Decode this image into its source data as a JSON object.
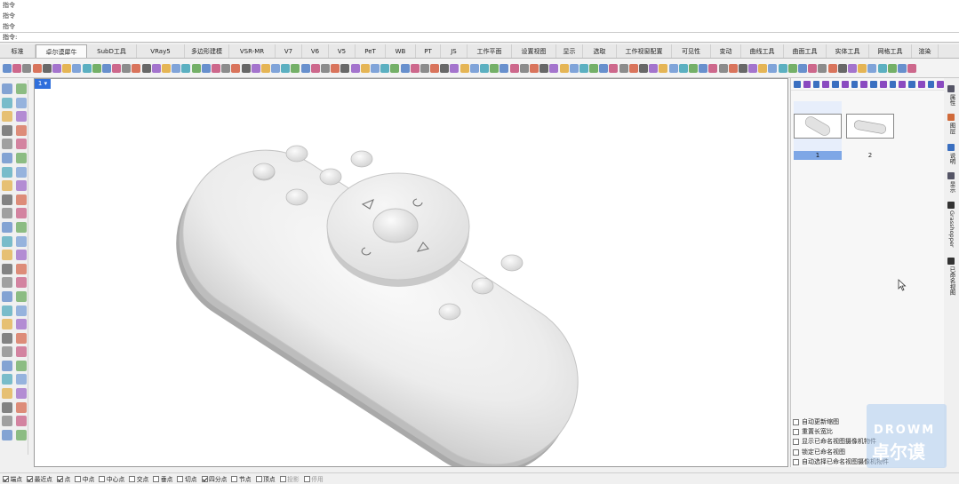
{
  "command_history": [
    "指令",
    "指令",
    "指令"
  ],
  "command_prompt": "指令:",
  "tabs": [
    {
      "label": "标准",
      "w": 40
    },
    {
      "label": "卓尔谟犀牛",
      "w": 58,
      "active": true
    },
    {
      "label": "SubD工具",
      "w": 56
    },
    {
      "label": "VRay5",
      "w": 54
    },
    {
      "label": "多边形建模",
      "w": 50
    },
    {
      "label": "VSR-MR",
      "w": 52
    },
    {
      "label": "V7",
      "w": 30
    },
    {
      "label": "V6",
      "w": 30
    },
    {
      "label": "V5",
      "w": 30
    },
    {
      "label": "PeT",
      "w": 34
    },
    {
      "label": "WB",
      "w": 34
    },
    {
      "label": "PT",
      "w": 28
    },
    {
      "label": "JS",
      "w": 30
    },
    {
      "label": "工作平面",
      "w": 50
    },
    {
      "label": "设置视图",
      "w": 50
    },
    {
      "label": "显示",
      "w": 30
    },
    {
      "label": "选取",
      "w": 38
    },
    {
      "label": "工作视窗配置",
      "w": 62
    },
    {
      "label": "可见性",
      "w": 44
    },
    {
      "label": "变动",
      "w": 34
    },
    {
      "label": "曲线工具",
      "w": 48
    },
    {
      "label": "曲面工具",
      "w": 48
    },
    {
      "label": "实体工具",
      "w": 48
    },
    {
      "label": "网格工具",
      "w": 48
    },
    {
      "label": "渲染",
      "w": 30
    }
  ],
  "viewport": {
    "tab_label": "1"
  },
  "right_panel": {
    "thumbnails": [
      {
        "label": "1",
        "selected": true
      },
      {
        "label": "2",
        "selected": false
      }
    ],
    "options": [
      {
        "label": "自动更新缩图",
        "checked": false
      },
      {
        "label": "重置长宽比",
        "checked": false
      },
      {
        "label": "显示已命名视图摄像机物件",
        "checked": false
      },
      {
        "label": "锁定已命名视图",
        "checked": false
      },
      {
        "label": "自动选择已命名视图摄像机物件",
        "checked": false
      }
    ]
  },
  "side_tabs": [
    "属性",
    "图层",
    "说明",
    "显示",
    "Grasshopper",
    "已命名视图"
  ],
  "watermark": {
    "en": "DROWM",
    "cn": "卓尔谟"
  },
  "snaps": [
    {
      "label": "端点",
      "checked": true
    },
    {
      "label": "最近点",
      "checked": true
    },
    {
      "label": "点",
      "checked": true
    },
    {
      "label": "中点",
      "checked": false
    },
    {
      "label": "中心点",
      "checked": false
    },
    {
      "label": "交点",
      "checked": false
    },
    {
      "label": "垂点",
      "checked": false
    },
    {
      "label": "切点",
      "checked": false
    },
    {
      "label": "四分点",
      "checked": true
    },
    {
      "label": "节点",
      "checked": false
    },
    {
      "label": "顶点",
      "checked": false
    },
    {
      "label": "投影",
      "checked": false,
      "dim": true
    },
    {
      "label": "停用",
      "checked": false,
      "dim": true
    }
  ],
  "colors": {
    "accent": "#2f6fdc",
    "selected_thumb": "#7ea7e6",
    "model": "#ececec"
  }
}
